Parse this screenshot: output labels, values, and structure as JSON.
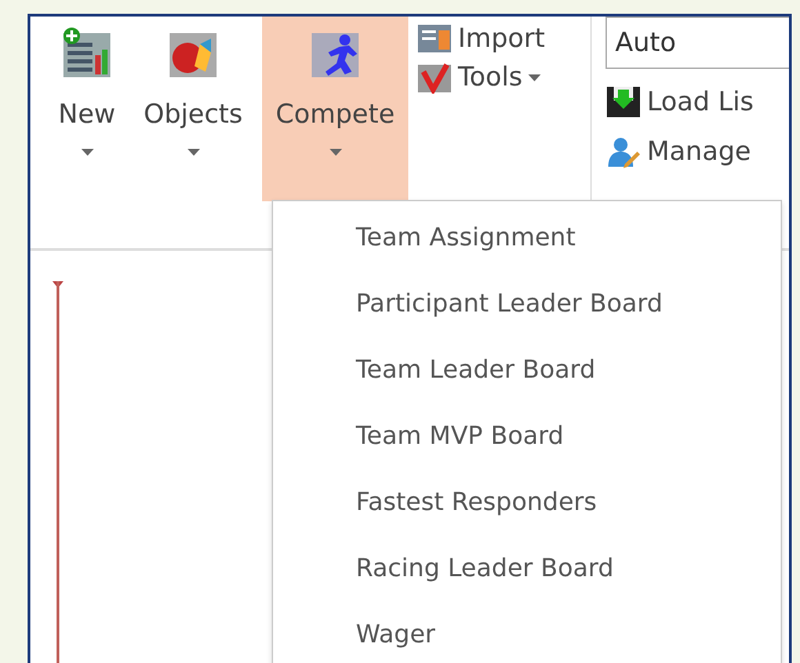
{
  "ribbon": {
    "large_buttons": [
      {
        "label": "New",
        "dropdown": true,
        "selected": false
      },
      {
        "label": "Objects",
        "dropdown": true,
        "selected": false
      },
      {
        "label": "Compete",
        "dropdown": true,
        "selected": true
      }
    ],
    "small_buttons": [
      {
        "label": "Import",
        "dropdown": false
      },
      {
        "label": "Tools",
        "dropdown": true
      }
    ],
    "combo": {
      "value": "Auto"
    },
    "side_buttons": [
      {
        "label": "Load Lis"
      },
      {
        "label": "Manage"
      }
    ]
  },
  "menu": {
    "items": [
      {
        "label": "Team Assignment"
      },
      {
        "label": "Participant Leader Board"
      },
      {
        "label": "Team Leader Board"
      },
      {
        "label": "Team MVP Board"
      },
      {
        "label": "Fastest Responders"
      },
      {
        "label": "Racing Leader Board"
      },
      {
        "label": "Wager"
      }
    ]
  }
}
